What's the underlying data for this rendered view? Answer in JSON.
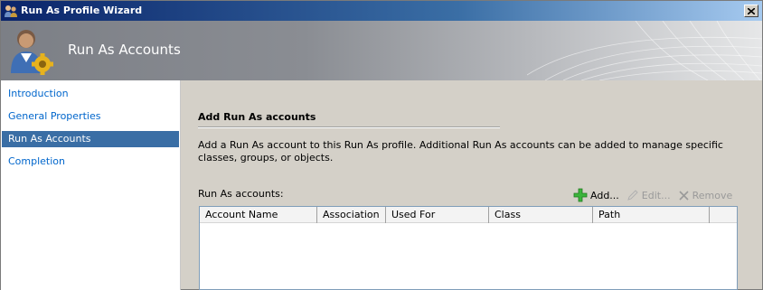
{
  "window": {
    "title": "Run As Profile Wizard"
  },
  "banner": {
    "title": "Run As Accounts"
  },
  "nav": {
    "items": [
      {
        "label": "Introduction",
        "selected": false
      },
      {
        "label": "General Properties",
        "selected": false
      },
      {
        "label": "Run As Accounts",
        "selected": true
      },
      {
        "label": "Completion",
        "selected": false
      }
    ]
  },
  "content": {
    "heading": "Add Run As accounts",
    "description": "Add a Run As account to this Run As profile.  Additional Run As accounts can be added to manage specific classes, groups, or objects.",
    "list_label": "Run As accounts:",
    "toolbar": {
      "add": "Add...",
      "edit": "Edit...",
      "remove": "Remove"
    },
    "columns": [
      "Account Name",
      "Association",
      "Used For",
      "Class",
      "Path"
    ],
    "rows": []
  },
  "colors": {
    "selection": "#3a6ea5",
    "link": "#0066cc",
    "titlebar": "#0a246a",
    "add_icon": "#3cb43c"
  },
  "icons": {
    "app": "users-icon",
    "banner": "user-gear-icon",
    "add": "plus-icon",
    "edit": "pencil-icon",
    "remove": "x-icon",
    "close": "close-icon"
  }
}
